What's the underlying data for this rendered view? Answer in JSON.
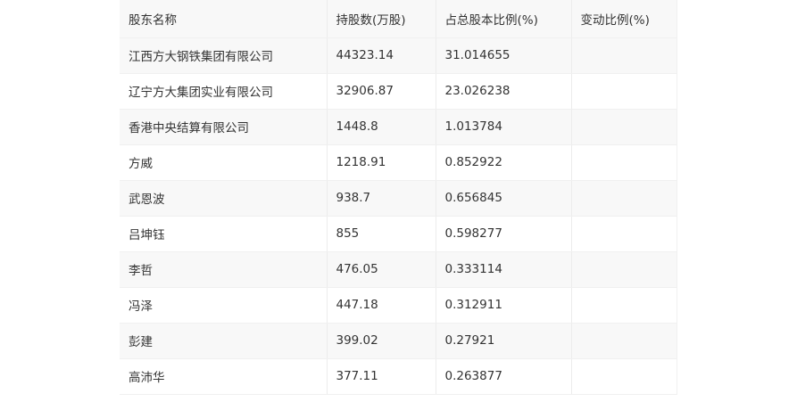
{
  "table": {
    "headers": [
      "股东名称",
      "持股数(万股)",
      "占总股本比例(%)",
      "变动比例(%)"
    ],
    "rows": [
      [
        "江西方大钢铁集团有限公司",
        "44323.14",
        "31.014655",
        ""
      ],
      [
        "辽宁方大集团实业有限公司",
        "32906.87",
        "23.026238",
        ""
      ],
      [
        "香港中央结算有限公司",
        "1448.8",
        "1.013784",
        ""
      ],
      [
        "方威",
        "1218.91",
        "0.852922",
        ""
      ],
      [
        "武恩波",
        "938.7",
        "0.656845",
        ""
      ],
      [
        "吕坤钰",
        "855",
        "0.598277",
        ""
      ],
      [
        "李哲",
        "476.05",
        "0.333114",
        ""
      ],
      [
        "冯泽",
        "447.18",
        "0.312911",
        ""
      ],
      [
        "彭建",
        "399.02",
        "0.27921",
        ""
      ],
      [
        "高沛华",
        "377.11",
        "0.263877",
        ""
      ]
    ]
  }
}
